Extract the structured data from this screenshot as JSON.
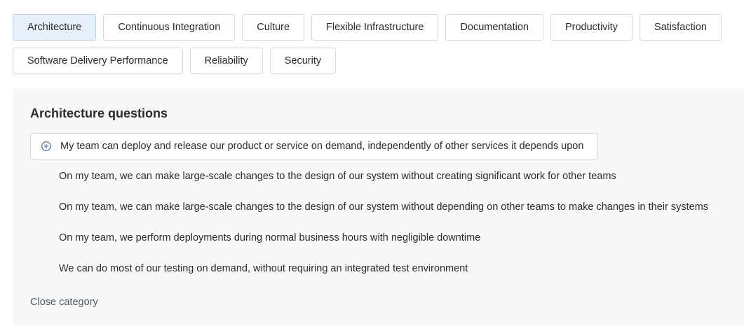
{
  "categories": [
    {
      "label": "Architecture",
      "active": true
    },
    {
      "label": "Continuous Integration",
      "active": false
    },
    {
      "label": "Culture",
      "active": false
    },
    {
      "label": "Flexible Infrastructure",
      "active": false
    },
    {
      "label": "Documentation",
      "active": false
    },
    {
      "label": "Productivity",
      "active": false
    },
    {
      "label": "Satisfaction",
      "active": false
    },
    {
      "label": "Software Delivery Performance",
      "active": false
    },
    {
      "label": "Reliability",
      "active": false
    },
    {
      "label": "Security",
      "active": false
    }
  ],
  "panel": {
    "title": "Architecture questions",
    "selected_question": "My team can deploy and release our product or service on demand, independently of other services it depends upon",
    "questions": [
      "On my team, we can make large-scale changes to the design of our system without creating significant work for other teams",
      "On my team, we can make large-scale changes to the design of our system without depending on other teams to make changes in their systems",
      "On my team, we perform deployments during normal business hours with negligible downtime",
      "We can do most of our testing on demand, without requiring an integrated test environment"
    ],
    "close_label": "Close category"
  },
  "colors": {
    "active_chip_bg": "#e8f0fb",
    "accent_icon": "#4a6fa5",
    "panel_bg": "#f7f8fa"
  },
  "icons": {
    "selected_question": "plus-circle-icon"
  }
}
